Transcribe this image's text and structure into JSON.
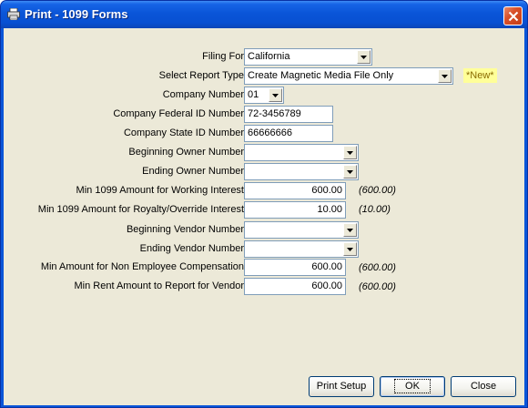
{
  "window": {
    "title": "Print - 1099 Forms"
  },
  "form": {
    "filing_for": {
      "label": "Filing For",
      "value": "California"
    },
    "report_type": {
      "label": "Select Report Type",
      "value": "Create Magnetic Media File Only",
      "badge": "*New*"
    },
    "company_number": {
      "label": "Company Number",
      "value": "01"
    },
    "federal_id": {
      "label": "Company Federal ID Number",
      "value": "72-3456789"
    },
    "state_id": {
      "label": "Company State ID Number",
      "value": "66666666"
    },
    "beginning_owner": {
      "label": "Beginning Owner Number",
      "value": ""
    },
    "ending_owner": {
      "label": "Ending Owner Number",
      "value": ""
    },
    "min_working_interest": {
      "label": "Min 1099 Amount for Working Interest",
      "value": "600.00",
      "default": "(600.00)"
    },
    "min_royalty": {
      "label": "Min 1099 Amount for Royalty/Override Interest",
      "value": "10.00",
      "default": "(10.00)"
    },
    "beginning_vendor": {
      "label": "Beginning Vendor Number",
      "value": ""
    },
    "ending_vendor": {
      "label": "Ending Vendor Number",
      "value": ""
    },
    "min_non_employee": {
      "label": "Min Amount for Non Employee Compensation",
      "value": "600.00",
      "default": "(600.00)"
    },
    "min_rent": {
      "label": "Min Rent Amount to Report for Vendor",
      "value": "600.00",
      "default": "(600.00)"
    }
  },
  "buttons": {
    "print_setup": "Print Setup",
    "ok": "OK",
    "close": "Close"
  },
  "colors": {
    "titlebar": "#0a55d8",
    "dialog_bg": "#ece9d8",
    "badge_bg": "#ffff99",
    "close_button": "#d9502a"
  }
}
